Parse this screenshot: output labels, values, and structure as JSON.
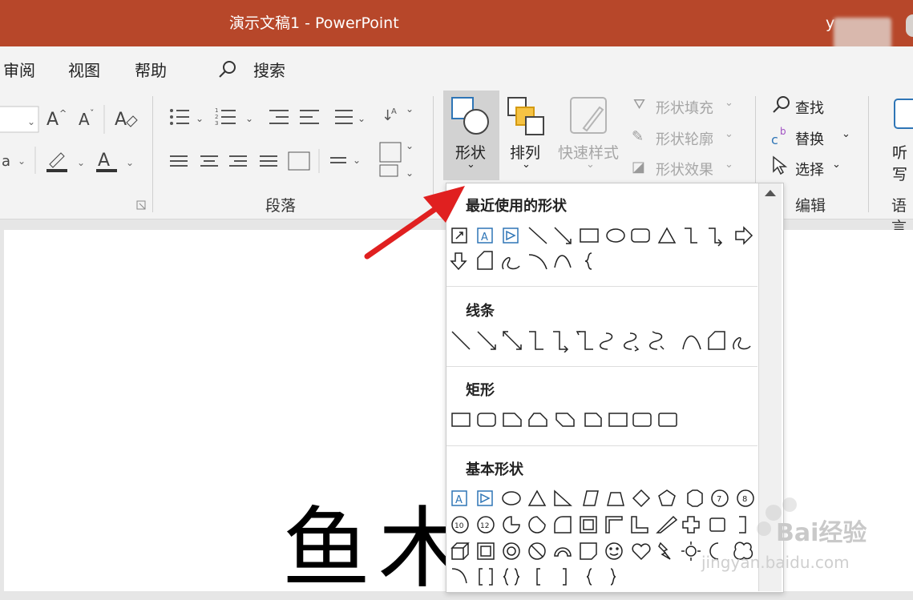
{
  "window": {
    "title": "演示文稿1 - PowerPoint",
    "user": "y"
  },
  "tabs": [
    "审阅",
    "视图",
    "帮助"
  ],
  "search": {
    "label": "搜索"
  },
  "ribbon": {
    "groups": {
      "paragraph": "段落",
      "editing": "编辑",
      "language": "语言"
    },
    "drawing": {
      "shapes": "形状",
      "arrange": "排列",
      "quick_styles": "快速样式",
      "shape_fill": "形状填充",
      "shape_outline": "形状轮廓",
      "shape_effects": "形状效果"
    },
    "editing": {
      "find": "查找",
      "replace": "替换",
      "select": "选择"
    },
    "language": {
      "listen": "听写"
    }
  },
  "shapes_gallery": {
    "categories": [
      "最近使用的形状",
      "线条",
      "矩形",
      "基本形状"
    ]
  },
  "slide": {
    "text": "鱼木"
  },
  "watermark": {
    "brand": "Bai经验",
    "url": "jingyan.baidu.com"
  },
  "colors": {
    "titlebar": "#b7472a",
    "arrow": "#e02020",
    "accent": "#2e75b6"
  }
}
